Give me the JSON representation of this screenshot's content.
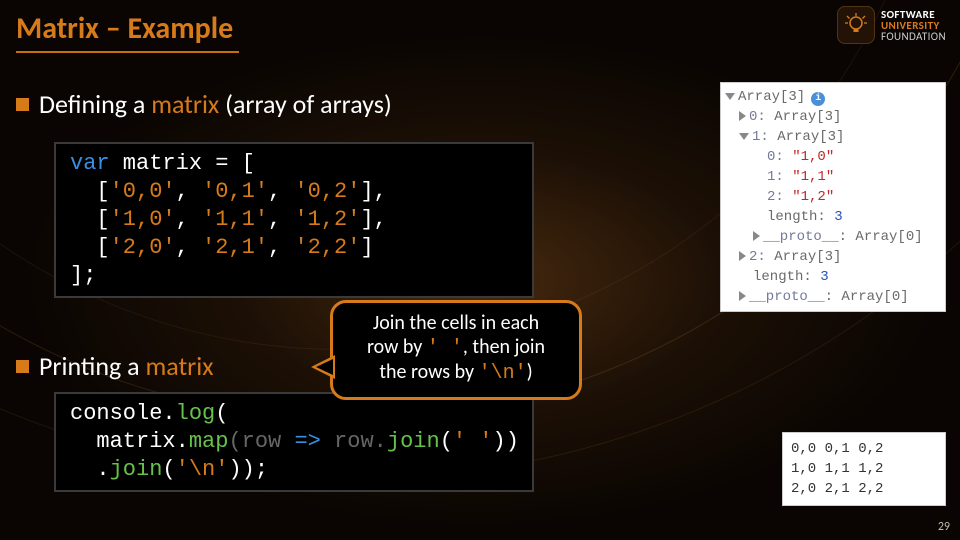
{
  "title": "Matrix – Example",
  "logo": {
    "line1": "SOFTWARE",
    "line2": "UNIVERSITY",
    "line3": "FOUNDATION"
  },
  "bullets": {
    "b1_pre": "Defining a ",
    "b1_kw": "matrix",
    "b1_post": " (array of arrays)",
    "b2_pre": "Printing a ",
    "b2_kw": "matrix"
  },
  "code1": {
    "l1a": "var",
    "l1b": " matrix = [",
    "l2a": "  [",
    "l2b": "'0,0'",
    "l2c": ", ",
    "l2d": "'0,1'",
    "l2e": ", ",
    "l2f": "'0,2'",
    "l2g": "],",
    "l3a": "  [",
    "l3b": "'1,0'",
    "l3c": ", ",
    "l3d": "'1,1'",
    "l3e": ", ",
    "l3f": "'1,2'",
    "l3g": "],",
    "l4a": "  [",
    "l4b": "'2,0'",
    "l4c": ", ",
    "l4d": "'2,1'",
    "l4e": ", ",
    "l4f": "'2,2'",
    "l4g": "]",
    "l5": "];"
  },
  "callout": {
    "l1": "Join the cells in each",
    "l2a": "row by ",
    "l2b": "' '",
    "l2c": ", then join",
    "l3a": "the rows by ",
    "l3b": "'\\n'",
    "l3c": ")"
  },
  "code2": {
    "l1a": "console.",
    "l1b": "log",
    "l1c": "(",
    "l2a": "  matrix.",
    "l2b": "map",
    "l2c": "(row ",
    "l2d": "=>",
    "l2e": " row.",
    "l2f": "join",
    "l2g": "(",
    "l2h": "' '",
    "l2i": "))",
    "l3a": "  .",
    "l3b": "join",
    "l3c": "(",
    "l3d": "'\\n'",
    "l3e": "));"
  },
  "inspector": {
    "r0": "Array[3]",
    "r1a": "0: ",
    "r1b": "Array[3]",
    "r2a": "1: ",
    "r2b": "Array[3]",
    "r3a": "0: ",
    "r3b": "\"1,0\"",
    "r4a": "1: ",
    "r4b": "\"1,1\"",
    "r5a": "2: ",
    "r5b": "\"1,2\"",
    "r6a": "length: ",
    "r6b": "3",
    "r7a": "__proto__",
    "r7b": ": Array[0]",
    "r8a": "2: ",
    "r8b": "Array[3]",
    "r9a": "length: ",
    "r9b": "3",
    "r10a": "__proto__",
    "r10b": ": Array[0]"
  },
  "output": {
    "l1": "0,0 0,1 0,2",
    "l2": "1,0 1,1 1,2",
    "l3": "2,0 2,1 2,2"
  },
  "page_number": "29"
}
